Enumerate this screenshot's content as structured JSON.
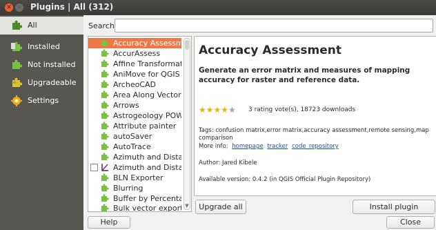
{
  "window": {
    "title": "Plugins | All (312)"
  },
  "sidebar": {
    "items": [
      {
        "label": "All",
        "icon": "puzzle-all-icon"
      },
      {
        "label": "Installed",
        "icon": "puzzle-installed-icon"
      },
      {
        "label": "Not installed",
        "icon": "puzzle-not-installed-icon"
      },
      {
        "label": "Upgradeable",
        "icon": "puzzle-upgradeable-icon"
      },
      {
        "label": "Settings",
        "icon": "gear-settings-icon"
      }
    ]
  },
  "search": {
    "label": "Search",
    "value": ""
  },
  "plugins": [
    "Accuracy Assessment",
    "AccurAssess",
    "Affine Transformation",
    "AniMove for QGIS",
    "ArcheoCAD",
    "Area Along Vector",
    "Arrows",
    "Astrogeology POW",
    "Attribute painter",
    "autoSaver",
    "AutoTrace",
    "Azimuth and Distance",
    "Azimuth and Distance",
    "BLN Exporter",
    "Blurring",
    "Buffer by Percentage",
    "Bulk vector export"
  ],
  "details": {
    "name": "Accuracy Assessment",
    "description": "Generate an error matrix and measures of mapping accuracy for raster and reference data.",
    "rating_stars": 4,
    "votes": "3 rating vote(s), 18723 downloads",
    "tags": "Tags: confusion matrix,error matrix,accuracy assessment,remote sensing,map comparison",
    "more_info_label": "More info:",
    "links": [
      "homepage",
      "tracker",
      "code_repository"
    ],
    "author": "Author: Jared Kibele",
    "version": "Available version: 0.4.2 (in QGIS Official Plugin Repository)"
  },
  "buttons": {
    "upgrade_all": "Upgrade all",
    "install": "Install plugin",
    "help": "Help",
    "close": "Close"
  },
  "colors": {
    "selection": "#f07746",
    "sidebar": "#575651",
    "link": "#1a4fb8",
    "star": "#e9b30c"
  }
}
